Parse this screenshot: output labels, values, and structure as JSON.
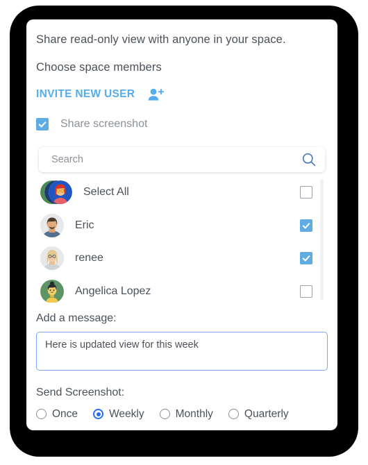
{
  "dialog": {
    "headline": "Share read-only view with anyone in your space.",
    "subhead": "Choose space members",
    "invite_link_label": "INVITE NEW USER",
    "invite_icon": "person-add-icon"
  },
  "share_screenshot": {
    "label": "Share screenshot",
    "checked": true
  },
  "search": {
    "placeholder": "Search",
    "value": "",
    "icon": "search-icon"
  },
  "members": [
    {
      "name": "Select All",
      "checked": false,
      "avatar": "avatar-group"
    },
    {
      "name": "Eric",
      "checked": true,
      "avatar": "photo-male"
    },
    {
      "name": "renee",
      "checked": true,
      "avatar": "photo-female"
    },
    {
      "name": "Angelica Lopez",
      "checked": false,
      "avatar": "illustration-female-green"
    }
  ],
  "message": {
    "label": "Add a message:",
    "value": "Here is updated view for this week"
  },
  "send_screenshot": {
    "label": "Send Screenshot:",
    "selected": "Weekly",
    "options": [
      "Once",
      "Weekly",
      "Monthly",
      "Quarterly"
    ]
  },
  "colors": {
    "accent_blue": "#54adec",
    "checkbox_blue": "#5eace3",
    "radio_blue": "#2b6ef5",
    "text": "#4b5059",
    "muted_text": "#8b9099",
    "focus_border": "#7aa7f0"
  }
}
